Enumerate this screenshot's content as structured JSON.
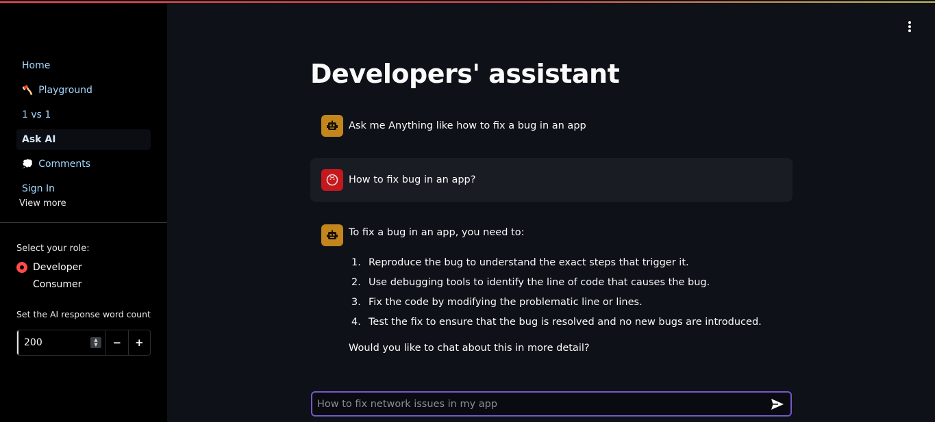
{
  "sidebar": {
    "nav_items": [
      {
        "label": "Home",
        "icon": ""
      },
      {
        "label": "Playground",
        "icon": "🪓"
      },
      {
        "label": "1 vs 1",
        "icon": ""
      },
      {
        "label": "Ask AI",
        "icon": "",
        "active": true
      },
      {
        "label": "Comments",
        "icon": "💭"
      },
      {
        "label": "Sign In",
        "icon": ""
      }
    ],
    "view_more": "View more",
    "role_label": "Select your role:",
    "roles": [
      "Developer",
      "Consumer"
    ],
    "selected_role": "Developer",
    "word_count_label": "Set the AI response word count",
    "word_count_value": "200",
    "decrement_label": "−",
    "increment_label": "+"
  },
  "main": {
    "title": "Developers' assistant",
    "messages": [
      {
        "role": "assistant",
        "text": "Ask me Anything like how to fix a bug in an app"
      },
      {
        "role": "user",
        "text": "How to fix bug in an app?"
      },
      {
        "role": "assistant",
        "intro": "To fix a bug in an app, you need to:",
        "steps": [
          {
            "num": "1.",
            "text": "Reproduce the bug to understand the exact steps that trigger it."
          },
          {
            "num": "2.",
            "text": "Use debugging tools to identify the line of code that causes the bug."
          },
          {
            "num": "3.",
            "text": "Fix the code by modifying the problematic line or lines."
          },
          {
            "num": "4.",
            "text": "Test the fix to ensure that the bug is resolved and no new bugs are introduced."
          }
        ],
        "closing": "Would you like to chat about this in more detail?"
      }
    ],
    "chat_input_placeholder": "How to fix network issues in my app"
  },
  "colors": {
    "background": "#0e1117",
    "sidebar": "#000000",
    "accent": "#ff4b4b",
    "link": "#a5d8ff",
    "bot_avatar": "#c2861d",
    "user_avatar": "#c4181f",
    "input_border": "#7659c9"
  },
  "icons": {
    "bot_avatar": "robot-icon",
    "user_avatar": "face-icon",
    "menu": "vertical-dots-icon",
    "send": "send-icon"
  }
}
